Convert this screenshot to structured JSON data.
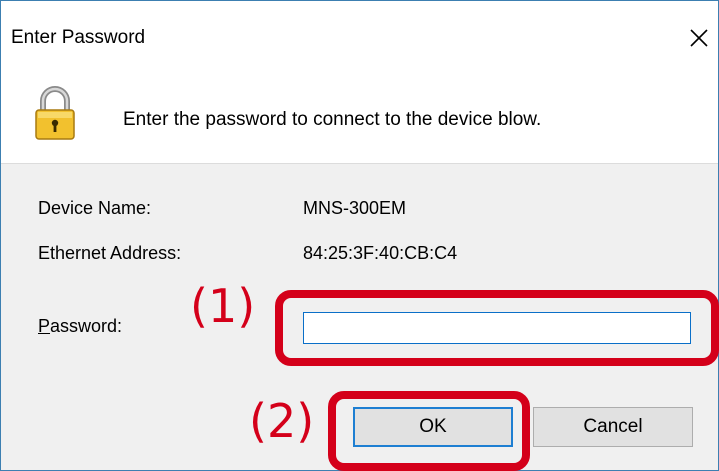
{
  "dialog": {
    "title": "Enter Password",
    "message": "Enter the password to connect to the device blow.",
    "device_name_label": "Device Name:",
    "device_name_value": "MNS-300EM",
    "ethernet_label": "Ethernet Address:",
    "ethernet_value": "84:25:3F:40:CB:C4",
    "password_label_first": "P",
    "password_label_rest": "assword:",
    "password_value": "",
    "ok_label": "OK",
    "cancel_label": "Cancel"
  },
  "annotations": {
    "marker_1": "(1)",
    "marker_2": "(2)",
    "color": "#d4001a"
  },
  "icons": {
    "close": "close-icon",
    "lock": "lock-icon"
  }
}
